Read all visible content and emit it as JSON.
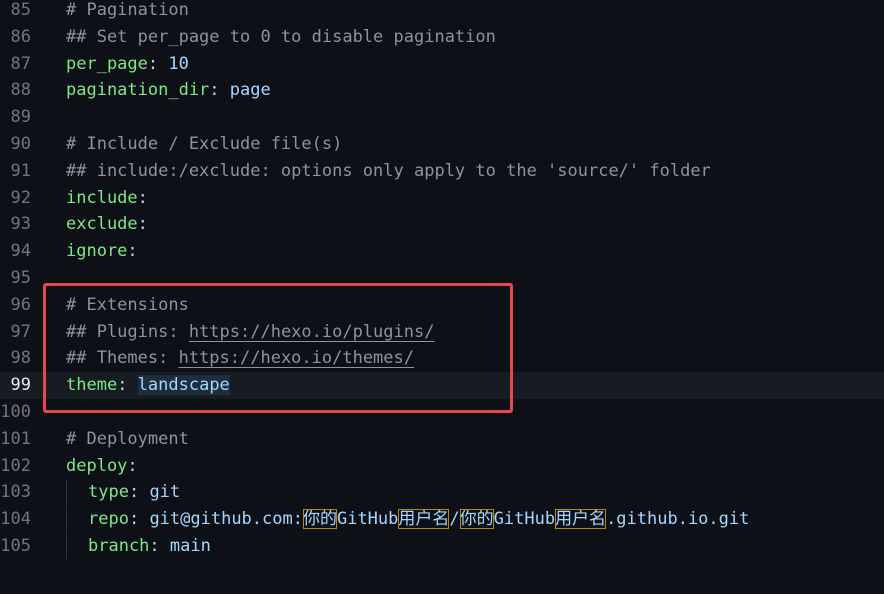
{
  "editor": {
    "lines": [
      {
        "n": "85",
        "parts": [
          [
            "comment",
            "# Pagination"
          ]
        ]
      },
      {
        "n": "86",
        "parts": [
          [
            "comment",
            "## Set per_page to 0 to disable pagination"
          ]
        ]
      },
      {
        "n": "87",
        "parts": [
          [
            "key",
            "per_page"
          ],
          [
            "plain",
            ": "
          ],
          [
            "val",
            "10"
          ]
        ]
      },
      {
        "n": "88",
        "parts": [
          [
            "key",
            "pagination_dir"
          ],
          [
            "plain",
            ": "
          ],
          [
            "val",
            "page"
          ]
        ]
      },
      {
        "n": "89",
        "parts": []
      },
      {
        "n": "90",
        "parts": [
          [
            "comment",
            "# Include / Exclude file(s)"
          ]
        ]
      },
      {
        "n": "91",
        "parts": [
          [
            "comment",
            "## include:/exclude: options only apply to the 'source/' folder"
          ]
        ]
      },
      {
        "n": "92",
        "parts": [
          [
            "key",
            "include"
          ],
          [
            "plain",
            ":"
          ]
        ]
      },
      {
        "n": "93",
        "parts": [
          [
            "key",
            "exclude"
          ],
          [
            "plain",
            ":"
          ]
        ]
      },
      {
        "n": "94",
        "parts": [
          [
            "key",
            "ignore"
          ],
          [
            "plain",
            ":"
          ]
        ]
      },
      {
        "n": "95",
        "parts": []
      },
      {
        "n": "96",
        "parts": [
          [
            "comment",
            "# Extensions"
          ]
        ]
      },
      {
        "n": "97",
        "parts": [
          [
            "comment",
            "## Plugins: "
          ],
          [
            "comment link",
            "https://hexo.io/plugins/"
          ]
        ]
      },
      {
        "n": "98",
        "parts": [
          [
            "comment",
            "## Themes: "
          ],
          [
            "comment link",
            "https://hexo.io/themes/"
          ]
        ]
      },
      {
        "n": "99",
        "current": true,
        "parts": [
          [
            "key",
            "theme"
          ],
          [
            "plain",
            ": "
          ],
          [
            "val sel",
            "landscape"
          ]
        ]
      },
      {
        "n": "100",
        "parts": []
      },
      {
        "n": "101",
        "parts": [
          [
            "comment",
            "# Deployment"
          ]
        ]
      },
      {
        "n": "102",
        "parts": [
          [
            "key",
            "deploy"
          ],
          [
            "plain",
            ":"
          ]
        ]
      },
      {
        "n": "103",
        "indent": true,
        "parts": [
          [
            "key",
            "type"
          ],
          [
            "plain",
            ": "
          ],
          [
            "val",
            "git"
          ]
        ]
      },
      {
        "n": "104",
        "indent": true,
        "parts": [
          [
            "key",
            "repo"
          ],
          [
            "plain",
            ": "
          ],
          [
            "val",
            "git@github.com:"
          ],
          [
            "val cjk",
            "你的"
          ],
          [
            "val",
            "GitHub"
          ],
          [
            "val cjk",
            "用户名"
          ],
          [
            "val",
            "/"
          ],
          [
            "val cjk",
            "你的"
          ],
          [
            "val",
            "GitHub"
          ],
          [
            "val cjk",
            "用户名"
          ],
          [
            "val",
            ".github.io.git"
          ]
        ]
      },
      {
        "n": "105",
        "indent": true,
        "parts": [
          [
            "key",
            "branch"
          ],
          [
            "plain",
            ": "
          ],
          [
            "val",
            "main"
          ]
        ]
      }
    ]
  },
  "colors": {
    "background": "#0d1117",
    "highlight_box": "#e5484d"
  }
}
